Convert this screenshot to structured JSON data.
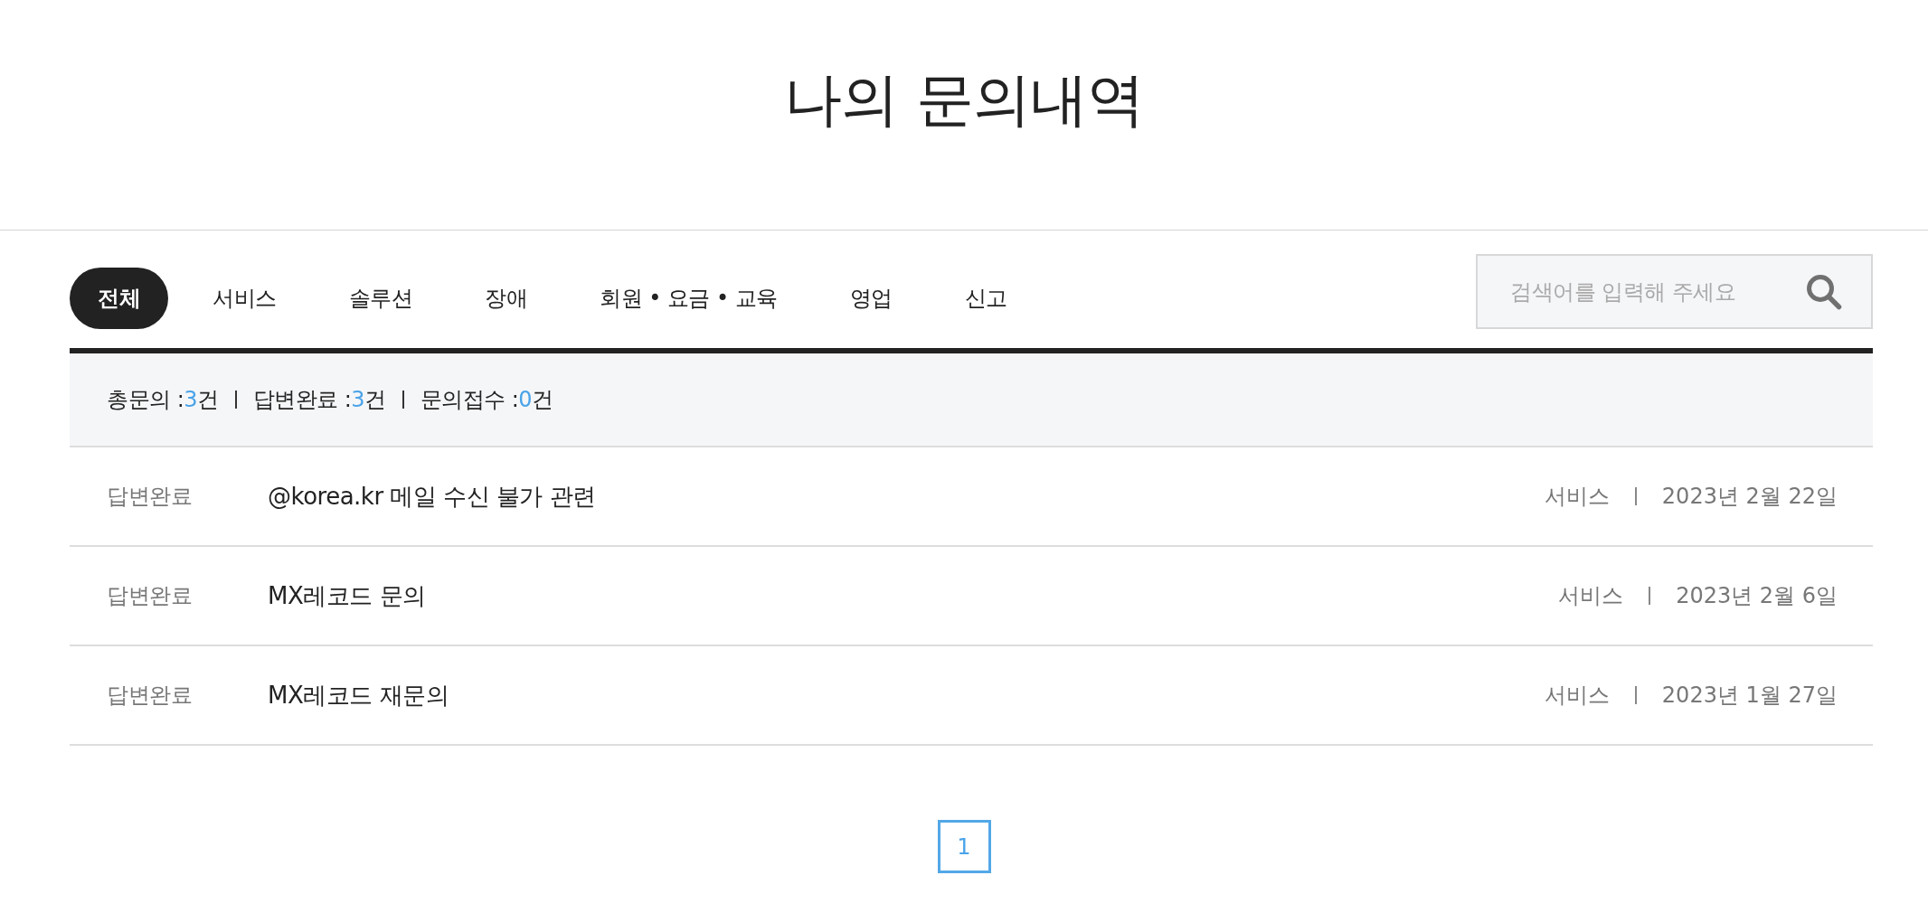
{
  "page_title": "나의 문의내역",
  "tabs": [
    {
      "label": "전체",
      "selected": true
    },
    {
      "label": "서비스",
      "selected": false
    },
    {
      "label": "솔루션",
      "selected": false
    },
    {
      "label": "장애",
      "selected": false
    },
    {
      "label": "회원 • 요금 • 교육",
      "selected": false
    },
    {
      "label": "영업",
      "selected": false
    },
    {
      "label": "신고",
      "selected": false
    }
  ],
  "search": {
    "placeholder": "검색어를 입력해 주세요"
  },
  "summary": [
    {
      "label": "총문의 :",
      "count": "3",
      "unit": "건"
    },
    {
      "label": "답변완료 :",
      "count": "3",
      "unit": "건"
    },
    {
      "label": "문의접수 :",
      "count": "0",
      "unit": "건"
    }
  ],
  "rows": [
    {
      "status": "답변완료",
      "title": "@korea.kr 메일 수신 불가 관련",
      "category": "서비스",
      "date": "2023년 2월 22일"
    },
    {
      "status": "답변완료",
      "title": "MX레코드 문의",
      "category": "서비스",
      "date": "2023년 2월 6일"
    },
    {
      "status": "답변완료",
      "title": "MX레코드 재문의",
      "category": "서비스",
      "date": "2023년 1월 27일"
    }
  ],
  "pagination": [
    {
      "label": "1",
      "selected": true
    }
  ]
}
